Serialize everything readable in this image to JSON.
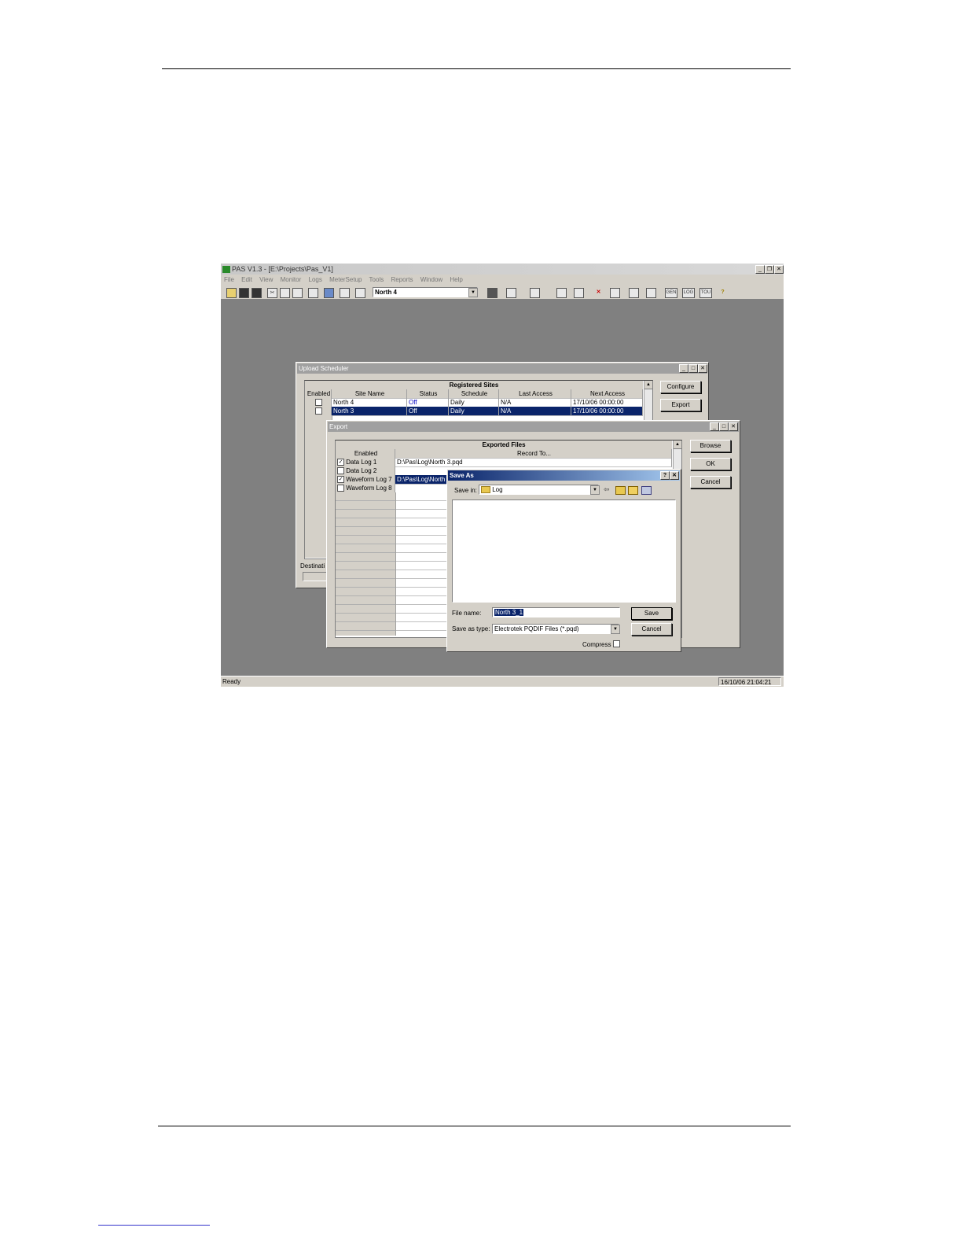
{
  "app": {
    "title": "PAS V1.3 - [E:\\Projects\\Pas_V1]",
    "menu": [
      "File",
      "Edit",
      "View",
      "Monitor",
      "Logs",
      "MeterSetup",
      "Tools",
      "Reports",
      "Window",
      "Help"
    ],
    "site_selector": "North 4",
    "toolbar_icons": [
      "open-icon",
      "save-icon",
      "save-all-icon",
      "cut-icon",
      "copy-icon",
      "paste-icon",
      "print-icon",
      "view-icon",
      "properties-icon",
      "connect-icon",
      "grid-icon",
      "monitor-icon",
      "data-icon",
      "graph-icon",
      "waveform-icon",
      "delete-icon",
      "clock-icon",
      "filter-icon",
      "export-icon",
      "gen-icon",
      "log-icon",
      "tou-icon",
      "help-icon"
    ],
    "toolbar_text": {
      "gen": "GEN",
      "log": "LOG",
      "tou": "TOU"
    },
    "status_left": "Ready",
    "status_right": "16/10/06 21:04:21"
  },
  "upload_scheduler": {
    "title": "Upload Scheduler",
    "grid_title": "Registered Sites",
    "columns": [
      "Enabled",
      "Site Name",
      "Status",
      "Schedule",
      "Last Access",
      "Next Access"
    ],
    "rows": [
      {
        "site": "North 4",
        "status": "Off",
        "schedule": "Daily",
        "last": "N/A",
        "next": "17/10/06 00:00:00"
      },
      {
        "site": "North 3",
        "status": "Off",
        "schedule": "Daily",
        "last": "N/A",
        "next": "17/10/06 00:00:00"
      }
    ],
    "buttons": {
      "configure": "Configure",
      "export": "Export"
    },
    "destination_label": "Destinati"
  },
  "export": {
    "title": "Export",
    "grid_title": "Exported Files",
    "columns": [
      "Enabled",
      "Record To..."
    ],
    "rows": [
      {
        "name": "Data Log 1",
        "checked": true,
        "path": "D:\\Pas\\Log\\North 3.pqd"
      },
      {
        "name": "Data Log 2",
        "checked": false,
        "path": ""
      },
      {
        "name": "Waveform Log 7",
        "checked": true,
        "path": "D:\\Pas\\Log\\North 3"
      },
      {
        "name": "Waveform Log 8",
        "checked": false,
        "path": ""
      }
    ],
    "buttons": {
      "browse": "Browse",
      "ok": "OK",
      "cancel": "Cancel"
    }
  },
  "save_as": {
    "title": "Save As",
    "save_in_label": "Save in:",
    "save_in_value": "Log",
    "file_name_label": "File name:",
    "file_name_value": "North 3_1",
    "save_type_label": "Save as type:",
    "save_type_value": "Electrotek PQDIF Files (*.pqd)",
    "compress_label": "Compress",
    "buttons": {
      "save": "Save",
      "cancel": "Cancel"
    }
  }
}
